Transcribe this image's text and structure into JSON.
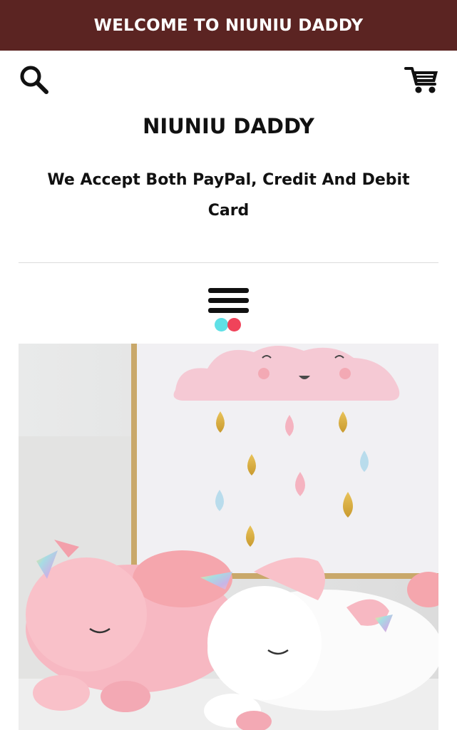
{
  "announcement": {
    "text": "WELCOME TO NIUNIU DADDY"
  },
  "header": {
    "search_icon": "search-icon",
    "cart_icon": "cart-icon",
    "shop_name": "NIUNIU DADDY",
    "tagline": "We Accept Both PayPal, Credit And Debit Card",
    "menu_icon": "hamburger-menu-icon"
  },
  "colors": {
    "announcement_bg": "#5b2422",
    "announcement_text": "#ffffff",
    "dot_cyan": "#5fe0e6",
    "dot_red": "#f0435a"
  },
  "hero": {
    "image": "pink and white unicorn plush toys lying in front of a cloud and raindrop wall picture"
  }
}
